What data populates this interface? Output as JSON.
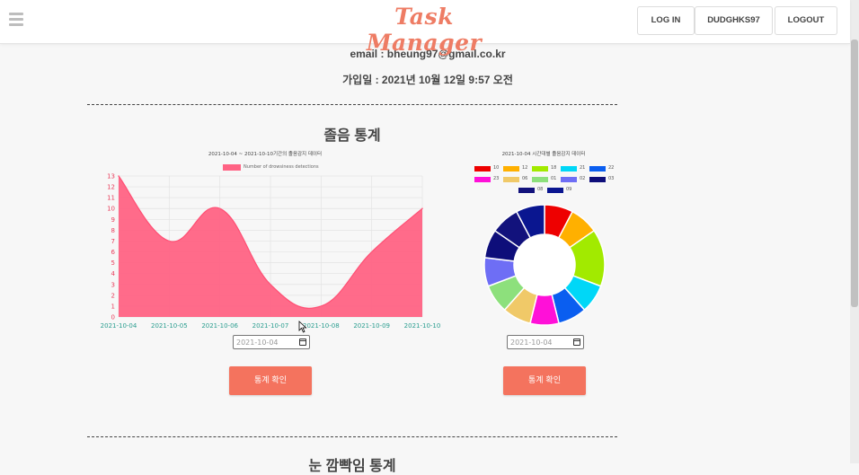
{
  "header": {
    "brand": "Task Manager",
    "login_label": "LOG IN",
    "user_label": "DUDGHKS97",
    "logout_label": "LOGOUT"
  },
  "profile": {
    "email_line": "email : bheung97@gmail.co.kr",
    "joined_line": "가입일 : 2021년 10월 12일 9:57 오전"
  },
  "section": {
    "title": "졸음 통계",
    "next_title": "눈 깜빡임 통계"
  },
  "colors": {
    "accent": "#ee7c64",
    "button": "#f4735e",
    "area_fill": "#ff6384"
  },
  "area_chart": {
    "date_value": "2021-10-04",
    "button_label": "통계 확인"
  },
  "donut_chart": {
    "date_value": "2021-10-04",
    "button_label": "통계 확인"
  },
  "chart_data": [
    {
      "type": "area",
      "title": "2021-10-04 ~ 2021-10-10기간의 졸음감지 데이터",
      "x": [
        "2021-10-04",
        "2021-10-05",
        "2021-10-06",
        "2021-10-07",
        "2021-10-08",
        "2021-10-09",
        "2021-10-10"
      ],
      "series": [
        {
          "name": "Number of drowsiness detections",
          "values": [
            13,
            7,
            10,
            3,
            1,
            6,
            10
          ]
        }
      ],
      "ylim": [
        0,
        13
      ],
      "yticks": [
        0,
        1,
        2,
        3,
        4,
        5,
        6,
        7,
        8,
        9,
        10,
        11,
        12,
        13
      ],
      "grid": true,
      "legend": "top-center",
      "color": "#ff6384"
    },
    {
      "type": "pie",
      "title": "2021-10-04 시간대별 졸음감지 데이터",
      "categories": [
        "10",
        "12",
        "18",
        "21",
        "22",
        "23",
        "06",
        "01",
        "02",
        "03",
        "08",
        "09"
      ],
      "values": [
        1,
        1,
        2,
        1,
        1,
        1,
        1,
        1,
        1,
        1,
        1,
        1
      ],
      "colors": [
        "#ee0000",
        "#ffb000",
        "#a2ea00",
        "#00d7f7",
        "#0a5ef0",
        "#ff10d8",
        "#f0c968",
        "#8de07c",
        "#6e6ef5",
        "#0e0e7a",
        "#12127c",
        "#0a1690"
      ],
      "legend": "top"
    }
  ]
}
